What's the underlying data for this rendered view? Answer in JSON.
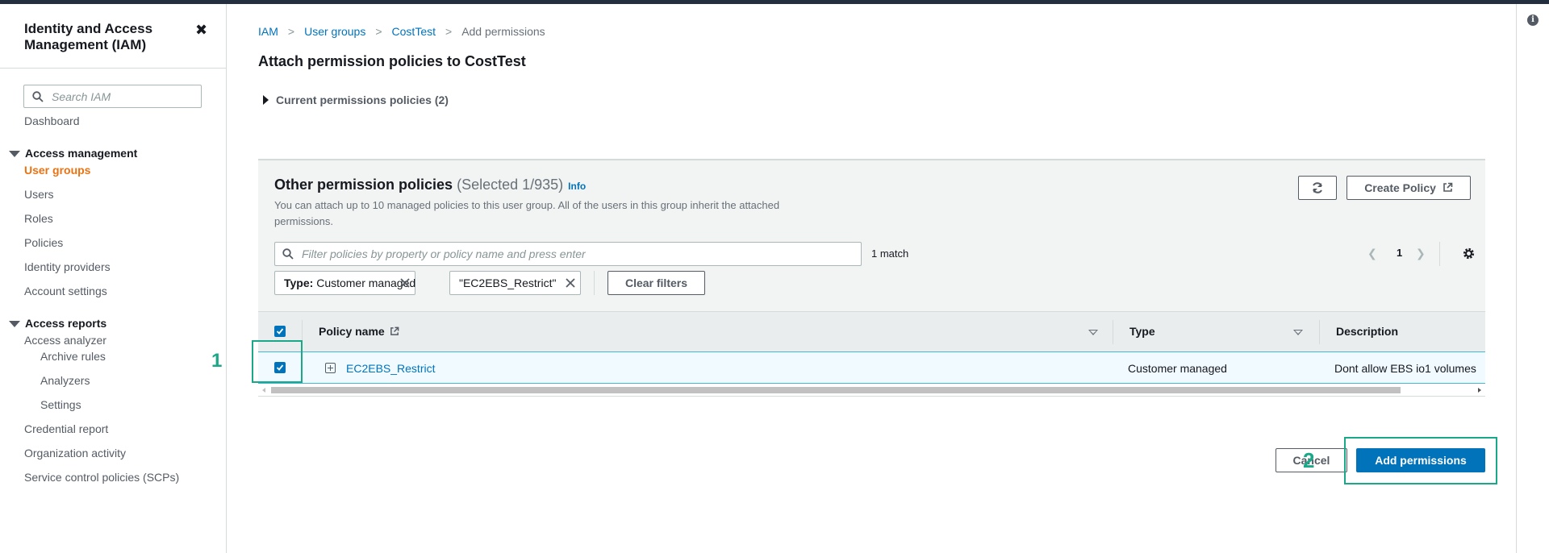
{
  "sidebar": {
    "title": "Identity and Access Management (IAM)",
    "close_glyph": "✖",
    "search_placeholder": "Search IAM",
    "dashboard": "Dashboard",
    "access_management": {
      "label": "Access management",
      "items": [
        "User groups",
        "Users",
        "Roles",
        "Policies",
        "Identity providers",
        "Account settings"
      ],
      "active": "User groups"
    },
    "access_reports": {
      "label": "Access reports",
      "analyzer": "Access analyzer",
      "analyzer_items": [
        "Archive rules",
        "Analyzers",
        "Settings"
      ],
      "items": [
        "Credential report",
        "Organization activity",
        "Service control policies (SCPs)"
      ]
    }
  },
  "breadcrumb": {
    "items": [
      "IAM",
      "User groups",
      "CostTest"
    ],
    "current": "Add permissions"
  },
  "page_title": "Attach permission policies to CostTest",
  "current_policies_label": "Current permissions policies (2)",
  "panel": {
    "title": "Other permission policies",
    "count": "(Selected 1/935)",
    "info": "Info",
    "description": "You can attach up to 10 managed policies to this user group. All of the users in this group inherit the attached permissions.",
    "create_policy": "Create Policy",
    "filter_placeholder": "Filter policies by property or policy name and press enter",
    "match": "1 match",
    "page": "1",
    "tokens": [
      {
        "key": "Type:",
        "value": " Customer managed"
      },
      {
        "key": "",
        "value": "\"EC2EBS_Restrict\""
      }
    ],
    "clear_filters": "Clear filters",
    "columns": [
      "Policy name",
      "Type",
      "Description"
    ],
    "rows": [
      {
        "name": "EC2EBS_Restrict",
        "type": "Customer managed",
        "description": "Dont allow EBS io1 volumes",
        "selected": true
      }
    ]
  },
  "annotations": [
    "1",
    "2"
  ],
  "footer": {
    "cancel": "Cancel",
    "add": "Add permissions"
  },
  "colors": {
    "link": "#0073bb",
    "active_nav": "#ec7211",
    "primary": "#0073bb",
    "annotation": "#1aa888"
  }
}
